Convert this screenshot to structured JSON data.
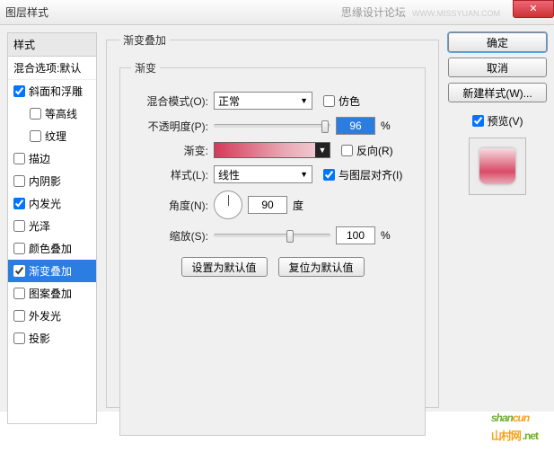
{
  "window": {
    "title": "图层样式",
    "brand": "思缘设计论坛",
    "url": "WWW.MISSYUAN.COM"
  },
  "left": {
    "header": "样式",
    "blend_default": "混合选项:默认",
    "items": [
      {
        "label": "斜面和浮雕",
        "checked": true,
        "indent": false
      },
      {
        "label": "等高线",
        "checked": false,
        "indent": true
      },
      {
        "label": "纹理",
        "checked": false,
        "indent": true
      },
      {
        "label": "描边",
        "checked": false,
        "indent": false
      },
      {
        "label": "内阴影",
        "checked": false,
        "indent": false
      },
      {
        "label": "内发光",
        "checked": true,
        "indent": false
      },
      {
        "label": "光泽",
        "checked": false,
        "indent": false
      },
      {
        "label": "颜色叠加",
        "checked": false,
        "indent": false
      },
      {
        "label": "渐变叠加",
        "checked": true,
        "indent": false,
        "selected": true
      },
      {
        "label": "图案叠加",
        "checked": false,
        "indent": false
      },
      {
        "label": "外发光",
        "checked": false,
        "indent": false
      },
      {
        "label": "投影",
        "checked": false,
        "indent": false
      }
    ]
  },
  "center": {
    "group_title": "渐变叠加",
    "inner_title": "渐变",
    "blend_mode_label": "混合模式(O):",
    "blend_mode_value": "正常",
    "dither_label": "仿色",
    "opacity_label": "不透明度(P):",
    "opacity_value": "96",
    "percent": "%",
    "gradient_label": "渐变:",
    "reverse_label": "反向(R)",
    "style_label": "样式(L):",
    "style_value": "线性",
    "align_label": "与图层对齐(I)",
    "angle_label": "角度(N):",
    "angle_value": "90",
    "degree": "度",
    "scale_label": "缩放(S):",
    "scale_value": "100",
    "reset_default": "设置为默认值",
    "restore_default": "复位为默认值"
  },
  "right": {
    "ok": "确定",
    "cancel": "取消",
    "new_style": "新建样式(W)...",
    "preview_label": "预览(V)"
  },
  "watermark": {
    "text1": "shan",
    "text2": "cun",
    "sub": "山村网",
    "net": ".net"
  }
}
